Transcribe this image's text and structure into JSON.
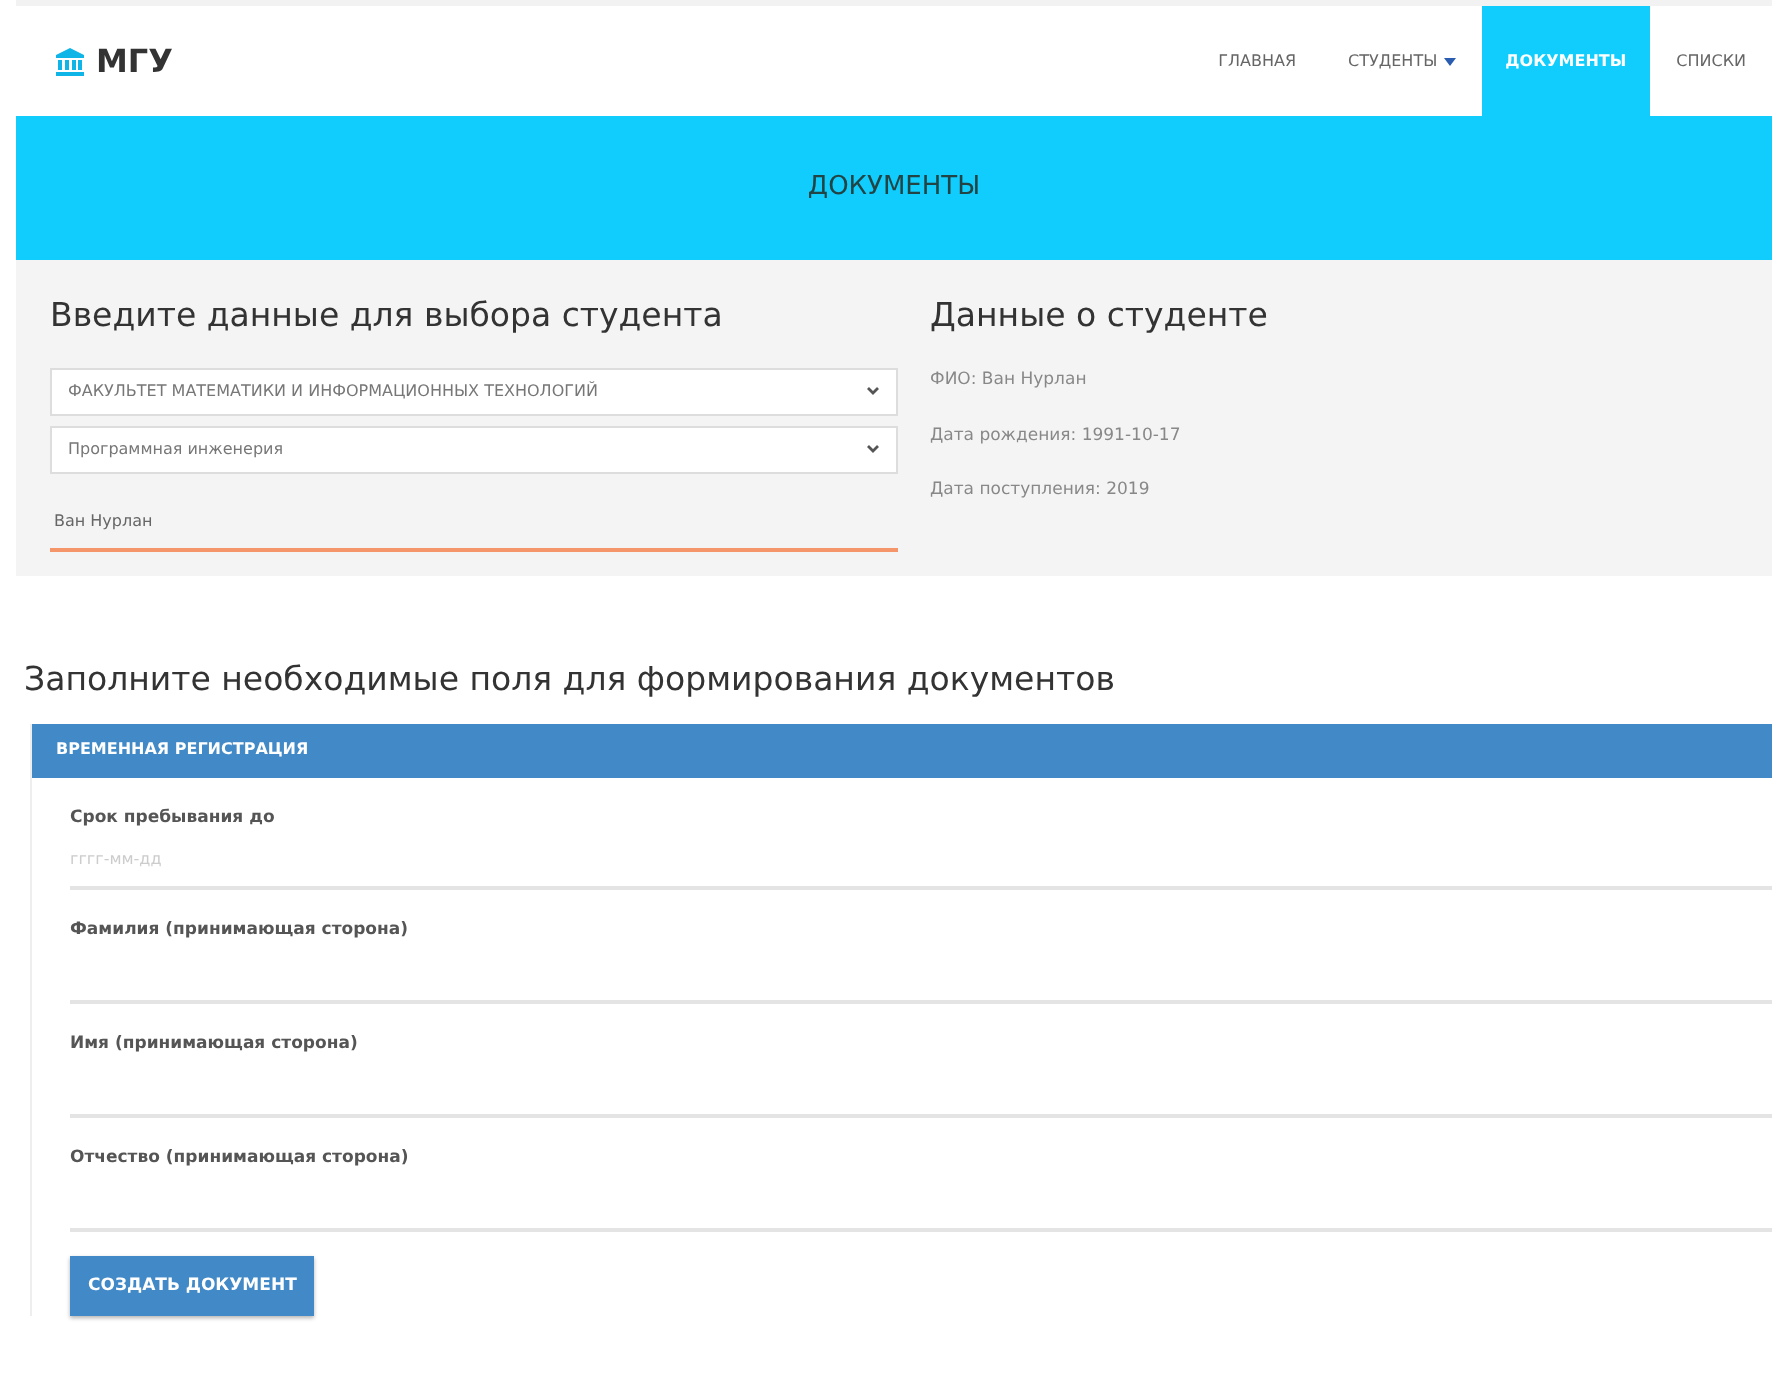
{
  "brand": {
    "title": "МГУ"
  },
  "nav": [
    {
      "label": "ГЛАВНАЯ",
      "selected": false,
      "kind": "link"
    },
    {
      "label": "СТУДЕНТЫ",
      "selected": false,
      "kind": "dropdown"
    },
    {
      "label": "ДОКУМЕНТЫ",
      "selected": true,
      "kind": "link"
    },
    {
      "label": "СПИСКИ",
      "selected": false,
      "kind": "link"
    }
  ],
  "hero": {
    "title": "ДОКУМЕНТЫ"
  },
  "selection": {
    "title": "Введите данные для выбора студента",
    "fields": [
      {
        "kind": "select",
        "value": "ФАКУЛЬТЕТ МАТЕМАТИКИ И ИНФОРМАЦИОННЫХ ТЕХНОЛОГИЙ"
      },
      {
        "kind": "select",
        "value": "Программная инженерия"
      },
      {
        "kind": "input",
        "value": "Ван Нурлан",
        "focused": true
      }
    ]
  },
  "student": {
    "title": "Данные о студенте",
    "lines": [
      "ФИО: Ван Нурлан",
      "Дата рождения: 1991-10-17",
      "Дата поступления: 2019"
    ]
  },
  "documents": {
    "title": "Заполните необходимые поля для формирования документов",
    "panel_title": "ВРЕМЕННАЯ РЕГИСТРАЦИЯ",
    "fields": [
      {
        "label": "Срок пребывания до",
        "placeholder": "гггг-мм-дд"
      },
      {
        "label": "Фамилия (принимающая сторона)"
      },
      {
        "label": "Имя (принимающая сторона)"
      },
      {
        "label": "Отчество (принимающая сторона)"
      }
    ],
    "button": "СОЗДАТЬ ДОКУМЕНТ"
  }
}
